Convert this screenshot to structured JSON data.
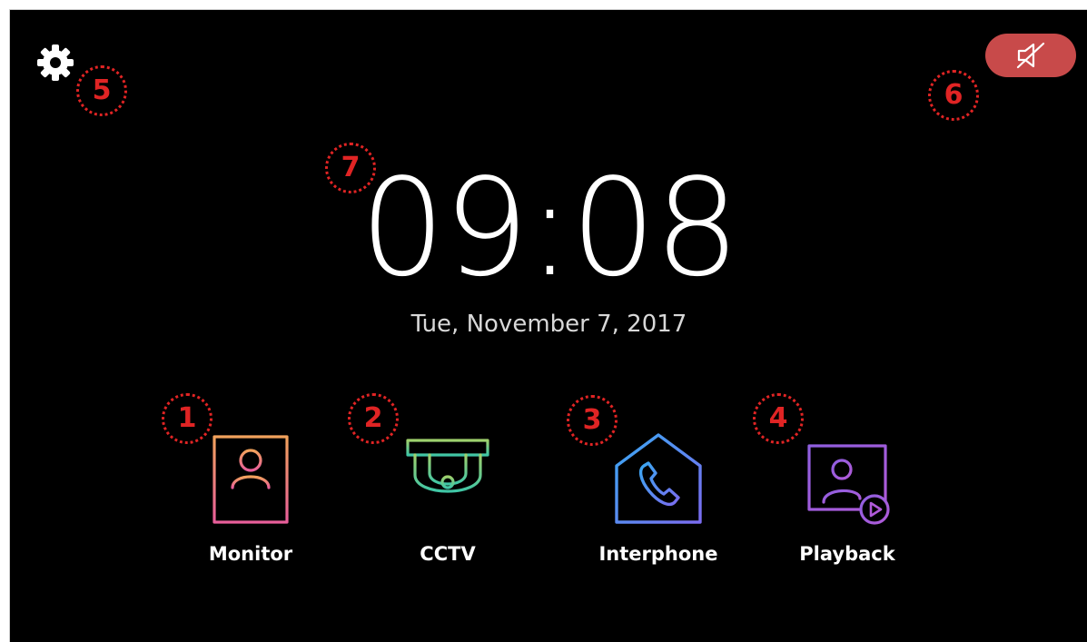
{
  "header": {
    "settings_icon": "gear-icon",
    "mute_icon": "speaker-muted-icon",
    "mute_button_color": "#c84a4a"
  },
  "clock": {
    "time": "09:08",
    "date": "Tue, November 7, 2017"
  },
  "apps": [
    {
      "label": "Monitor",
      "icon": "door-monitor-icon"
    },
    {
      "label": "CCTV",
      "icon": "dome-camera-icon"
    },
    {
      "label": "Interphone",
      "icon": "house-phone-icon"
    },
    {
      "label": "Playback",
      "icon": "video-playback-icon"
    }
  ],
  "callouts": [
    "1",
    "2",
    "3",
    "4",
    "5",
    "6",
    "7"
  ],
  "colors": {
    "background": "#000000",
    "callout": "#e02424"
  }
}
